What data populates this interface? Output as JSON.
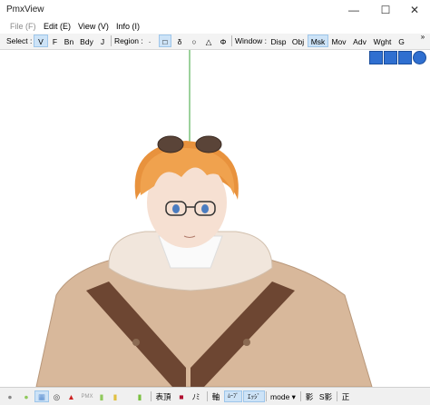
{
  "window": {
    "title": "PmxView",
    "minimize": "—",
    "maximize": "☐",
    "close": "✕"
  },
  "menu": [
    "File (F)",
    "Edit (E)",
    "View (V)",
    "Info (I)"
  ],
  "toolbar": {
    "select_label": "Select :",
    "select_buttons": [
      "V",
      "F",
      "Bn",
      "Bdy",
      "J"
    ],
    "region_label": "Region :",
    "region_buttons": [
      "·",
      "□",
      "δ",
      "○",
      "△",
      "Φ"
    ],
    "window_label": "Window :",
    "window_buttons": [
      "Disp",
      "Obj",
      "Msk",
      "Mov",
      "Adv",
      "Wght",
      "G"
    ],
    "overflow": "»"
  },
  "nav_icons": [
    "zoom-icon",
    "move-icon",
    "pen-icon",
    "rotate-icon"
  ],
  "statusbar": {
    "items": [
      "●",
      "●",
      "▦",
      "◎",
      "▲",
      "PMX",
      "▮",
      "▮",
      "▮",
      "表頂",
      "■",
      "ﾉﾐ",
      "軸",
      "ﾑｰﾌﾞ",
      "ｴｯｼﾞ",
      "mode ▾",
      "影",
      "S影",
      "正"
    ]
  },
  "colors": {
    "accent": "#cde3f7",
    "skin": "#f3d9c8",
    "hair": "#f0a24e",
    "jacket": "#d8b89b",
    "strap": "#6d4632",
    "bone_line": "#3aa53a"
  }
}
